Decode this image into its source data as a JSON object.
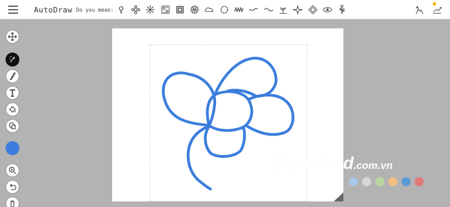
{
  "header": {
    "app_title": "AutoDraw",
    "did_you_mean_label": "Do you mean:",
    "suggestions": [
      "flower-icon",
      "sunflower-icon",
      "daisy-icon",
      "ornament-icon",
      "pattern-icon",
      "basketball-icon",
      "cloud-icon",
      "wreath-icon",
      "zigzag-icon",
      "swirl-icon",
      "wave-icon",
      "sprout-icon",
      "compass-rose-icon",
      "diamond-ornament-icon",
      "eye-icon",
      "cactus-icon"
    ]
  },
  "toolbar": {
    "tools": [
      "move-icon",
      "autodraw-icon",
      "draw-icon",
      "type-icon",
      "fill-icon",
      "shape-icon"
    ],
    "active_tool": "autodraw-icon",
    "selected_color": "#3b7ddd",
    "bottom_tools": [
      "zoom-icon",
      "undo-icon",
      "delete-icon"
    ]
  },
  "watermark": {
    "main": "Download",
    "suffix": ".com.vn",
    "dot_colors": [
      "#a8c8e8",
      "#d6d6d6",
      "#b9d6a0",
      "#f0c080",
      "#5b9bd5",
      "#e07a7a"
    ]
  },
  "colors": {
    "stroke": "#3b7ddd",
    "background": "#b3b3b3",
    "canvas": "#ffffff"
  }
}
